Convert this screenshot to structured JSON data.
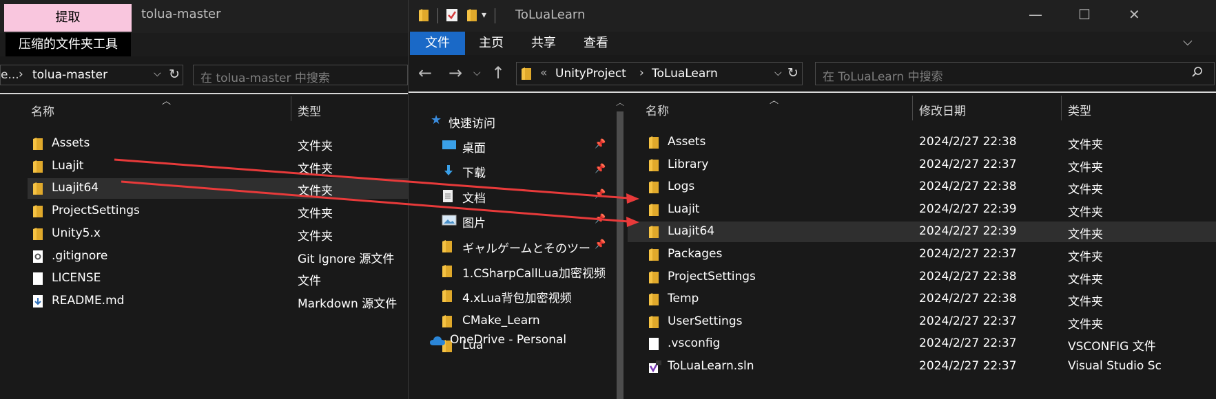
{
  "left_window": {
    "extract_tab": "提取",
    "title": "tolua-master",
    "tools_tab": "压缩的文件夹工具",
    "address": {
      "prefix": "e...",
      "crumb": "tolua-master"
    },
    "search_placeholder": "在 tolua-master 中搜索",
    "columns": {
      "name": "名称",
      "type": "类型"
    },
    "files": [
      {
        "name": "Assets",
        "type": "文件夹",
        "icon": "folder-icon"
      },
      {
        "name": "Luajit",
        "type": "文件夹",
        "icon": "folder-icon"
      },
      {
        "name": "Luajit64",
        "type": "文件夹",
        "icon": "folder-icon",
        "selected": true
      },
      {
        "name": "ProjectSettings",
        "type": "文件夹",
        "icon": "folder-icon"
      },
      {
        "name": "Unity5.x",
        "type": "文件夹",
        "icon": "folder-icon"
      },
      {
        "name": ".gitignore",
        "type": "Git Ignore 源文件",
        "icon": "gear-file-icon"
      },
      {
        "name": "LICENSE",
        "type": "文件",
        "icon": "blank-file-icon"
      },
      {
        "name": "README.md",
        "type": "Markdown 源文件",
        "icon": "markdown-file-icon"
      }
    ]
  },
  "right_window": {
    "title": "ToLuaLearn",
    "ribbon_tabs": [
      "文件",
      "主页",
      "共享",
      "查看"
    ],
    "address": {
      "crumbs": [
        "UnityProject",
        "ToLuaLearn"
      ]
    },
    "search_placeholder": "在 ToLuaLearn 中搜索",
    "columns": {
      "name": "名称",
      "date": "修改日期",
      "type": "类型"
    },
    "nav": {
      "quick_access": "快速访问",
      "items": [
        {
          "label": "桌面",
          "icon": "desktop-icon",
          "pinned": true
        },
        {
          "label": "下载",
          "icon": "download-icon",
          "pinned": true
        },
        {
          "label": "文档",
          "icon": "document-icon",
          "pinned": true
        },
        {
          "label": "图片",
          "icon": "picture-icon",
          "pinned": true
        },
        {
          "label": "ギャルゲームとそのツー",
          "icon": "folder-icon",
          "pinned": true
        },
        {
          "label": "1.CSharpCallLua加密视频",
          "icon": "folder-icon"
        },
        {
          "label": "4.xLua背包加密视频",
          "icon": "folder-icon"
        },
        {
          "label": "CMake_Learn",
          "icon": "folder-icon"
        },
        {
          "label": "Lua",
          "icon": "folder-icon"
        }
      ],
      "onedrive": "OneDrive - Personal"
    },
    "files": [
      {
        "name": "Assets",
        "date": "2024/2/27 22:38",
        "type": "文件夹",
        "icon": "folder-icon"
      },
      {
        "name": "Library",
        "date": "2024/2/27 22:37",
        "type": "文件夹",
        "icon": "folder-icon"
      },
      {
        "name": "Logs",
        "date": "2024/2/27 22:38",
        "type": "文件夹",
        "icon": "folder-icon"
      },
      {
        "name": "Luajit",
        "date": "2024/2/27 22:39",
        "type": "文件夹",
        "icon": "folder-icon"
      },
      {
        "name": "Luajit64",
        "date": "2024/2/27 22:39",
        "type": "文件夹",
        "icon": "folder-icon",
        "selected": true
      },
      {
        "name": "Packages",
        "date": "2024/2/27 22:37",
        "type": "文件夹",
        "icon": "folder-icon"
      },
      {
        "name": "ProjectSettings",
        "date": "2024/2/27 22:38",
        "type": "文件夹",
        "icon": "folder-icon"
      },
      {
        "name": "Temp",
        "date": "2024/2/27 22:38",
        "type": "文件夹",
        "icon": "folder-icon"
      },
      {
        "name": "UserSettings",
        "date": "2024/2/27 22:37",
        "type": "文件夹",
        "icon": "folder-icon"
      },
      {
        "name": ".vsconfig",
        "date": "2024/2/27 22:37",
        "type": "VSCONFIG 文件",
        "icon": "blank-file-icon"
      },
      {
        "name": "ToLuaLearn.sln",
        "date": "2024/2/27 22:37",
        "type": "Visual Studio Sc",
        "icon": "visual-studio-icon"
      }
    ]
  },
  "colors": {
    "arrow": "#e83a3a",
    "accent": "#1a69c7",
    "extract_tab": "#f9c6de",
    "folder": "#f5c243"
  }
}
